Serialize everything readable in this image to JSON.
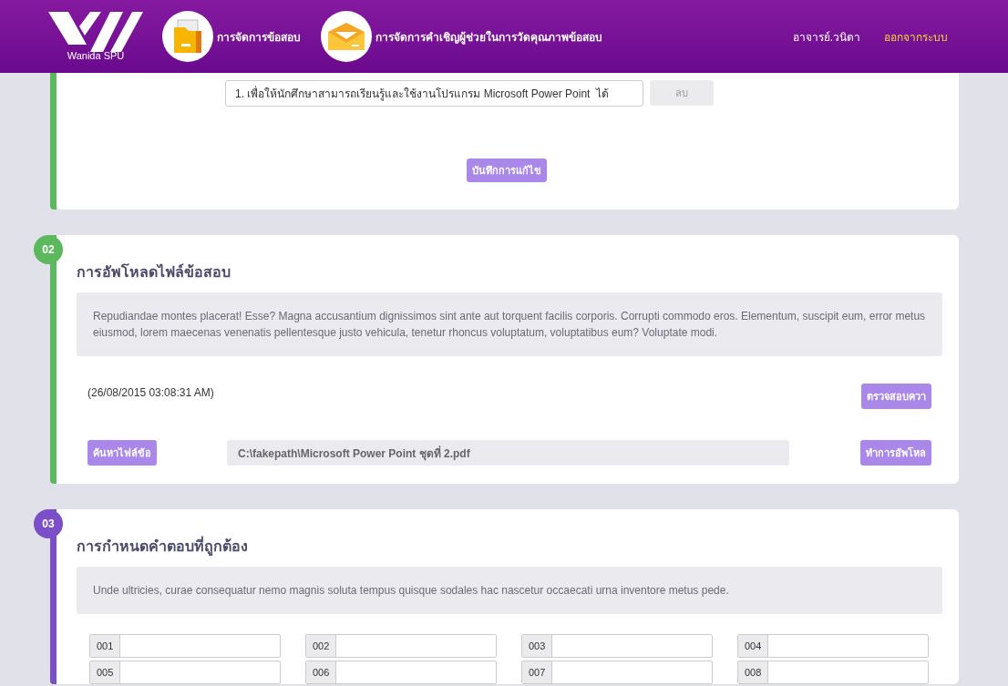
{
  "header": {
    "logo_text": "Wanida SPU",
    "nav": [
      {
        "label": "การจัดการข้อสอบ",
        "kind": "folder"
      },
      {
        "label": "การจัดการคำเชิญผู้ช่วยในการวัดคุณภาพข้อสอบ",
        "kind": "envelope"
      }
    ],
    "user": "อาจารย์.วนิดา",
    "logout": "ออกจากระบบ"
  },
  "sections": [
    {
      "kind": "objectives",
      "color": "#5cb85c",
      "objective_field": {
        "value": "1. เพื่อให้นักศึกษาสามารถเรียนรู้และใช้งานโปรแกรม Microsoft Power Point  ได้"
      },
      "delete_button": {
        "label": "ลบ",
        "disabled": true
      },
      "save_button": "บันทึกการแก้ไข"
    },
    {
      "kind": "upload",
      "color": "#5cb85c",
      "step": "02",
      "title": "การอัพโหลดไฟล์ข้อสอบ",
      "description": "Repudiandae montes placerat! Esse? Magna accusantium dignissimos sint ante aut torquent facilis corporis. Corrupti commodo eros. Elementum, suscipit eum, error metus eiusmod, lorem maecenas venenatis pellentesque justo vehicula, tenetur rhoncus voluptatum, voluptatibus eum? Voluptate modi.",
      "timestamp": "(26/08/2015 03:08:31 AM)",
      "check_button": "ตรวจสอบควา",
      "browse_button": "ค้นหาไฟล์ข้อ",
      "file_path": "C:\\fakepath\\Microsoft Power Point ชุดที่ 2.pdf",
      "upload_button": "ทำการอัพโหล"
    },
    {
      "kind": "answers",
      "color": "#7b4fc7",
      "step": "03",
      "title": "การกำหนดคำตอบที่ถูกต้อง",
      "description": "Unde ultricies, curae consequatur nemo magnis soluta tempus quisque sodales hac nascetur occaecati urna inventore metus pede.",
      "answers": [
        {
          "number": "001"
        },
        {
          "number": "002"
        },
        {
          "number": "003"
        },
        {
          "number": "004"
        },
        {
          "number": "005"
        },
        {
          "number": "006"
        },
        {
          "number": "007"
        },
        {
          "number": "008"
        }
      ]
    }
  ]
}
